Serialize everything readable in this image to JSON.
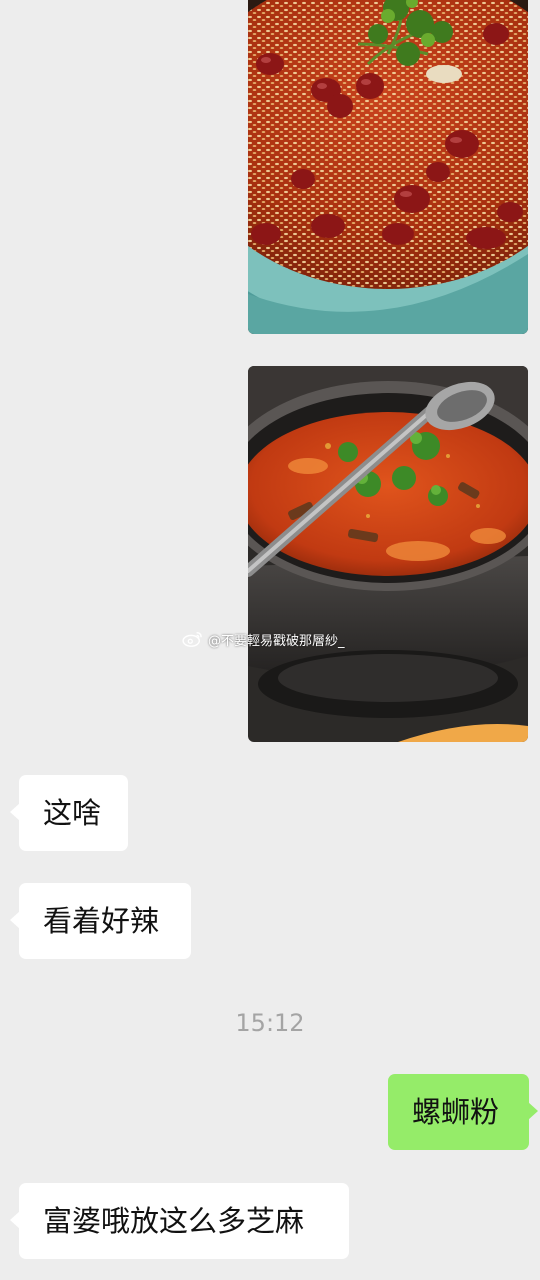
{
  "chat": {
    "background": "#ededed",
    "self_bubble_color": "#95ec69",
    "other_bubble_color": "#ffffff",
    "photos": [
      {
        "name": "spicy-noodle-dish-with-sesame-and-peanuts",
        "sender": "self"
      },
      {
        "name": "spicy-hotpot-with-ladle",
        "sender": "self"
      }
    ],
    "watermark": "@不要輕易戳破那層紗_",
    "timestamp": "15:12",
    "messages": [
      {
        "sender": "other",
        "text": "这啥"
      },
      {
        "sender": "other",
        "text": "看着好辣"
      },
      {
        "sender": "self",
        "text": "螺蛳粉"
      },
      {
        "sender": "other",
        "text": "富婆哦放这么多芝麻"
      }
    ]
  }
}
